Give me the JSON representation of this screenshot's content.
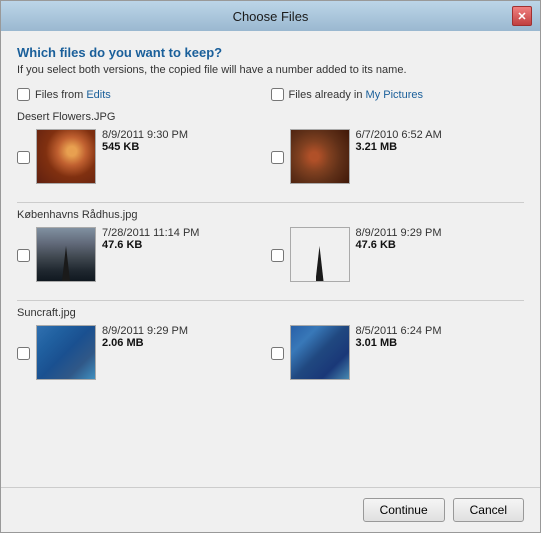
{
  "window": {
    "title": "Choose Files",
    "close_btn": "✕"
  },
  "header": {
    "question": "Which files do you want to keep?",
    "subtitle": "If you select both versions, the copied file will have a number added to its name."
  },
  "columns": {
    "left": {
      "label_prefix": "Files ",
      "label_from": "from",
      "label_link": "Edits"
    },
    "right": {
      "label_prefix": "Files already in",
      "label_link": "My Pictures"
    }
  },
  "files": [
    {
      "name": "Desert Flowers.JPG",
      "left": {
        "date": "8/9/2011 9:30 PM",
        "size": "545 KB"
      },
      "right": {
        "date": "6/7/2010 6:52 AM",
        "size": "3.21 MB"
      }
    },
    {
      "name": "Københavns Rådhus.jpg",
      "left": {
        "date": "7/28/2011 11:14 PM",
        "size": "47.6 KB"
      },
      "right": {
        "date": "8/9/2011 9:29 PM",
        "size": "47.6 KB"
      }
    },
    {
      "name": "Suncraft.jpg",
      "left": {
        "date": "8/9/2011 9:29 PM",
        "size": "2.06 MB"
      },
      "right": {
        "date": "8/5/2011 6:24 PM",
        "size": "3.01 MB"
      }
    }
  ],
  "buttons": {
    "continue": "Continue",
    "cancel": "Cancel"
  }
}
